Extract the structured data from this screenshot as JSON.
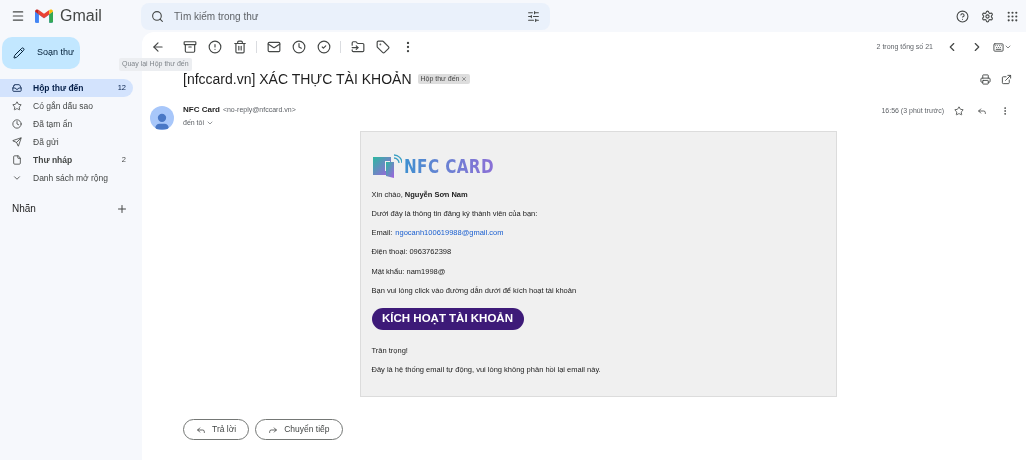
{
  "app": {
    "name": "Gmail"
  },
  "search": {
    "placeholder": "Tìm kiếm trong thư"
  },
  "compose": {
    "label": "Soạn thư"
  },
  "tooltip": {
    "text": "Quay lại Hộp thư đến"
  },
  "sidebar": {
    "items": [
      {
        "label": "Hộp thư đến",
        "count": "12",
        "selected": true,
        "bold": true
      },
      {
        "label": "Có gắn dấu sao",
        "selected": false,
        "bold": false
      },
      {
        "label": "Đã tạm ẩn",
        "selected": false,
        "bold": false
      },
      {
        "label": "Đã gửi",
        "selected": false,
        "bold": false
      },
      {
        "label": "Thư nháp",
        "count": "2",
        "selected": false,
        "bold": true
      },
      {
        "label": "Danh sách mở rộng",
        "selected": false,
        "bold": false
      }
    ],
    "labels_heading": "Nhãn"
  },
  "pager": {
    "text": "2 trong tổng số 21"
  },
  "message": {
    "subject": "[nfccard.vn] XÁC THỰC TÀI KHOẢN",
    "tag": "Hộp thư đến",
    "sender_name": "NFC Card",
    "sender_email": "<no-reply@nfccard.vn>",
    "recipient": "đến tôi",
    "time": "16:56 (3 phút trước)"
  },
  "email_body": {
    "logo": "NFC CARD",
    "greeting": "Xin chào, **Nguyễn Sơn Nam**",
    "intro": "Dưới đây là thông tin đăng ký thành viên của bạn:",
    "email_label": "Email:",
    "email_link": "ngocanh100619988@gmail.com",
    "phone": "Điện thoại: 0963762398",
    "password": "Mật khẩu: nam1998@",
    "instruction": "Bạn vui lòng click vào đường dẫn dưới để kích hoạt tài khoản",
    "button": "KÍCH HOẠT TÀI KHOẢN",
    "closing": "Trân trọng!",
    "footer": "Đây là hệ thống email tự động, vui lòng không phản hồi lại email này."
  },
  "actions": [
    "Trả lời",
    "Chuyển tiếp"
  ]
}
